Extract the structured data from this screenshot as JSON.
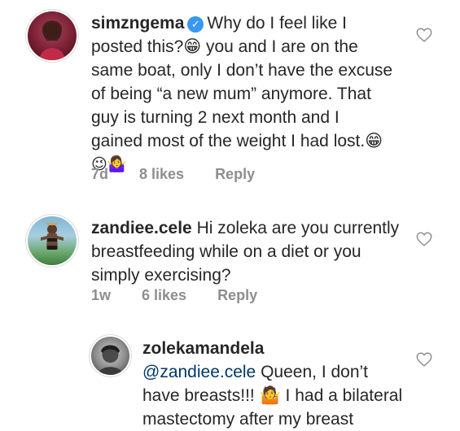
{
  "comments": [
    {
      "username": "simzngema",
      "verified": true,
      "text_lines": [
        "Why do I feel like I",
        "posted this?😁 you and I are on the",
        "same boat, only I don’t have the excuse",
        "of being “a new mum” anymore. That",
        "guy is turning 2 next month and I",
        "gained most of the weight I had lost.😁",
        "😉🤷‍♀️"
      ],
      "time": "7d",
      "likes": "8 likes",
      "reply": "Reply"
    },
    {
      "username": "zandiee.cele",
      "verified": false,
      "text_lines": [
        "Hi zoleka are you currently",
        "breastfeeding while on a diet or you",
        "simply exercising?"
      ],
      "time": "1w",
      "likes": "6 likes",
      "reply": "Reply"
    },
    {
      "username": "zolekamandela",
      "verified": false,
      "mention": "@zandiee.cele",
      "text_lines": [
        "Queen, I don’t",
        "have breasts!!! 🤷 I had a bilateral",
        "mastectomy after my breast"
      ]
    }
  ],
  "colors": {
    "text": "#262626",
    "meta": "#8e8e8e",
    "mention": "#00376b",
    "verified": "#3897f0"
  },
  "icons": {
    "like": "heart-outline-icon",
    "verified": "verified-badge-icon"
  }
}
